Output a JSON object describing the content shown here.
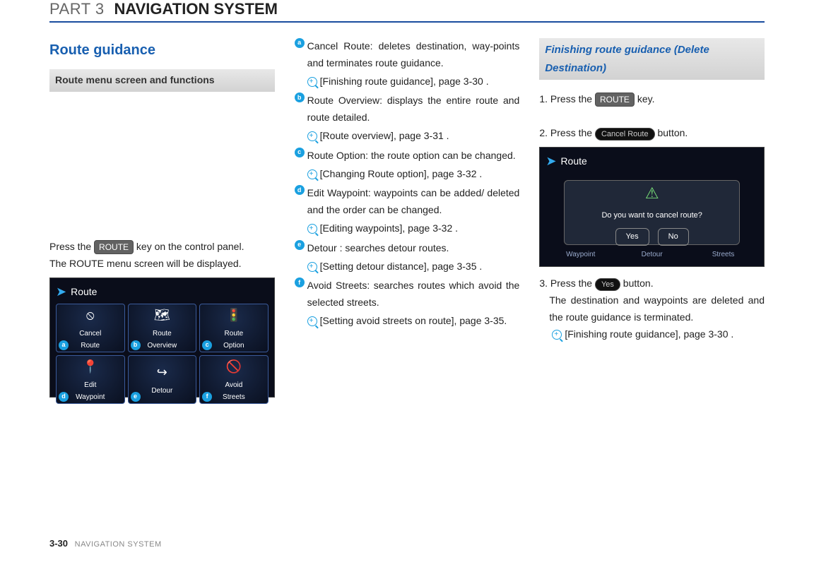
{
  "header": {
    "part": "PART 3",
    "title": "NAVIGATION SYSTEM"
  },
  "col1": {
    "h1": "Route guidance",
    "sub": "Route menu screen and functions",
    "p1a": "Press the ",
    "p1key": "ROUTE",
    "p1b": " key on the control panel.",
    "p2": "The ROUTE menu screen will be displayed.",
    "shot_title": "Route",
    "cells": [
      {
        "label": "Cancel\nRoute",
        "tag": "a",
        "icon": "⦸"
      },
      {
        "label": "Route\nOverview",
        "tag": "b",
        "icon": "🗺"
      },
      {
        "label": "Route\nOption",
        "tag": "c",
        "icon": "🚦"
      },
      {
        "label": "Edit\nWaypoint",
        "tag": "d",
        "icon": "📍"
      },
      {
        "label": "Detour",
        "tag": "e",
        "icon": "↪"
      },
      {
        "label": "Avoid\nStreets",
        "tag": "f",
        "icon": "🚫"
      }
    ]
  },
  "col2": {
    "items": [
      {
        "tag": "a",
        "text": "Cancel Route: deletes destination, way-points and terminates route guidance.",
        "ref": "[Finishing route guidance], page 3-30 ."
      },
      {
        "tag": "b",
        "text": "Route Overview: displays the entire route and route detailed.",
        "ref": "[Route overview], page 3-31 ."
      },
      {
        "tag": "c",
        "text": "Route Option: the route option can be changed.",
        "ref": "[Changing Route option], page 3-32 ."
      },
      {
        "tag": "d",
        "text": "Edit Waypoint: waypoints can be added/ deleted and the order can be changed.",
        "ref": "[Editing waypoints], page 3-32 ."
      },
      {
        "tag": "e",
        "text": "Detour : searches detour routes.",
        "ref": "[Setting detour distance], page 3-35 ."
      },
      {
        "tag": "f",
        "text": "Avoid Streets: searches routes which avoid the selected streets.",
        "ref": "[Setting avoid streets on route], page 3-35."
      }
    ]
  },
  "col3": {
    "sub": "Finishing route guidance (Delete Destination)",
    "s1a": "1. Press the ",
    "s1key": "ROUTE",
    "s1b": " key.",
    "s2a": "2. Press the ",
    "s2btn": "Cancel Route",
    "s2b": " button.",
    "shot_title": "Route",
    "dialog_text": "Do you want to cancel route?",
    "yes": "Yes",
    "no": "No",
    "ghost_waypoint": "Waypoint",
    "ghost_detour": "Detour",
    "ghost_streets": "Streets",
    "s3a": "3. Press the ",
    "s3btn": "Yes",
    "s3b": " button.",
    "s3p": "The destination and waypoints are deleted and the route guidance is terminated.",
    "s3ref": "[Finishing route guidance], page 3-30 ."
  },
  "footer": {
    "page": "3-30",
    "title": "NAVIGATION SYSTEM"
  }
}
